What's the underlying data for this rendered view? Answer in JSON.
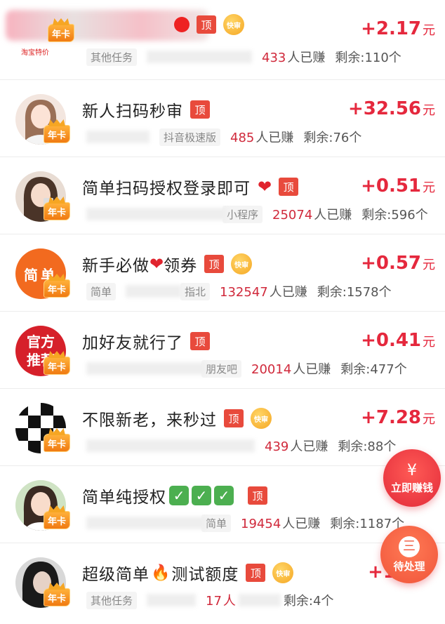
{
  "tasks": [
    {
      "title": "",
      "category": "其他任务",
      "category2": "",
      "earned": "433",
      "earned_suffix": "人已赚",
      "remaining": "剩余:110个",
      "reward": "+2.17",
      "unit": "元",
      "badge": "年卡",
      "top_tag": "顶",
      "fast_tag": "快审",
      "avatar_text": "淘宝特价"
    },
    {
      "title": "新人扫码秒审",
      "category": "",
      "category2": "抖音极速版",
      "earned": "485",
      "earned_suffix": "人已赚",
      "remaining": "剩余:76个",
      "reward": "+32.56",
      "unit": "元",
      "badge": "年卡",
      "top_tag": "顶"
    },
    {
      "title": "简单扫码授权登录即可",
      "category": "",
      "category2": "小程序",
      "earned": "25074",
      "earned_suffix": "人已赚",
      "remaining": "剩余:596个",
      "reward": "+0.51",
      "unit": "元",
      "badge": "年卡",
      "top_tag": "顶",
      "emoji": "❤"
    },
    {
      "title_a": "新手必做",
      "title_b": "领券",
      "category": "简单",
      "category2": "指北",
      "earned": "132547",
      "earned_suffix": "人已赚",
      "remaining": "剩余:1578个",
      "reward": "+0.57",
      "unit": "元",
      "badge": "年卡",
      "top_tag": "顶",
      "fast_tag": "快审",
      "emoji": "❤",
      "avatar_text": "简单"
    },
    {
      "title": "加好友就行了",
      "category": "",
      "category2": "朋友吧",
      "earned": "20014",
      "earned_suffix": "人已赚",
      "remaining": "剩余:477个",
      "reward": "+0.41",
      "unit": "元",
      "badge": "年卡",
      "top_tag": "顶",
      "avatar_text_1": "官方",
      "avatar_text_2": "推荐"
    },
    {
      "title": "不限新老，来秒过",
      "category": "",
      "category2": "",
      "earned": "439",
      "earned_suffix": "人已赚",
      "remaining": "剩余:88个",
      "reward": "+7.28",
      "unit": "元",
      "badge": "年卡",
      "top_tag": "顶",
      "fast_tag": "快审"
    },
    {
      "title": "简单纯授权",
      "category": "",
      "category2": "简单",
      "earned": "19454",
      "earned_suffix": "人已赚",
      "remaining": "剩余:1187个",
      "reward": "",
      "unit": "",
      "badge": "年卡",
      "top_tag": "顶",
      "checks": [
        "✓",
        "✓",
        "✓"
      ]
    },
    {
      "title_a": "超级简单",
      "title_b": "测试额度",
      "category": "其他任务",
      "category2": "",
      "earned": "17",
      "earned_suffix": "人",
      "remaining": "剩余:4个",
      "reward": "+1",
      "unit": "",
      "badge": "年卡",
      "top_tag": "顶",
      "fast_tag": "快审",
      "emoji": "🔥"
    }
  ],
  "fab": {
    "earn_icon": "¥",
    "earn_label": "立即赚钱",
    "pending_icon": "三",
    "pending_label": "待处理"
  },
  "colors": {
    "accent_red": "#e5283d",
    "tag_red": "#e84a3c",
    "badge_orange": "#f07a12",
    "fast_gold": "#f5a623"
  }
}
